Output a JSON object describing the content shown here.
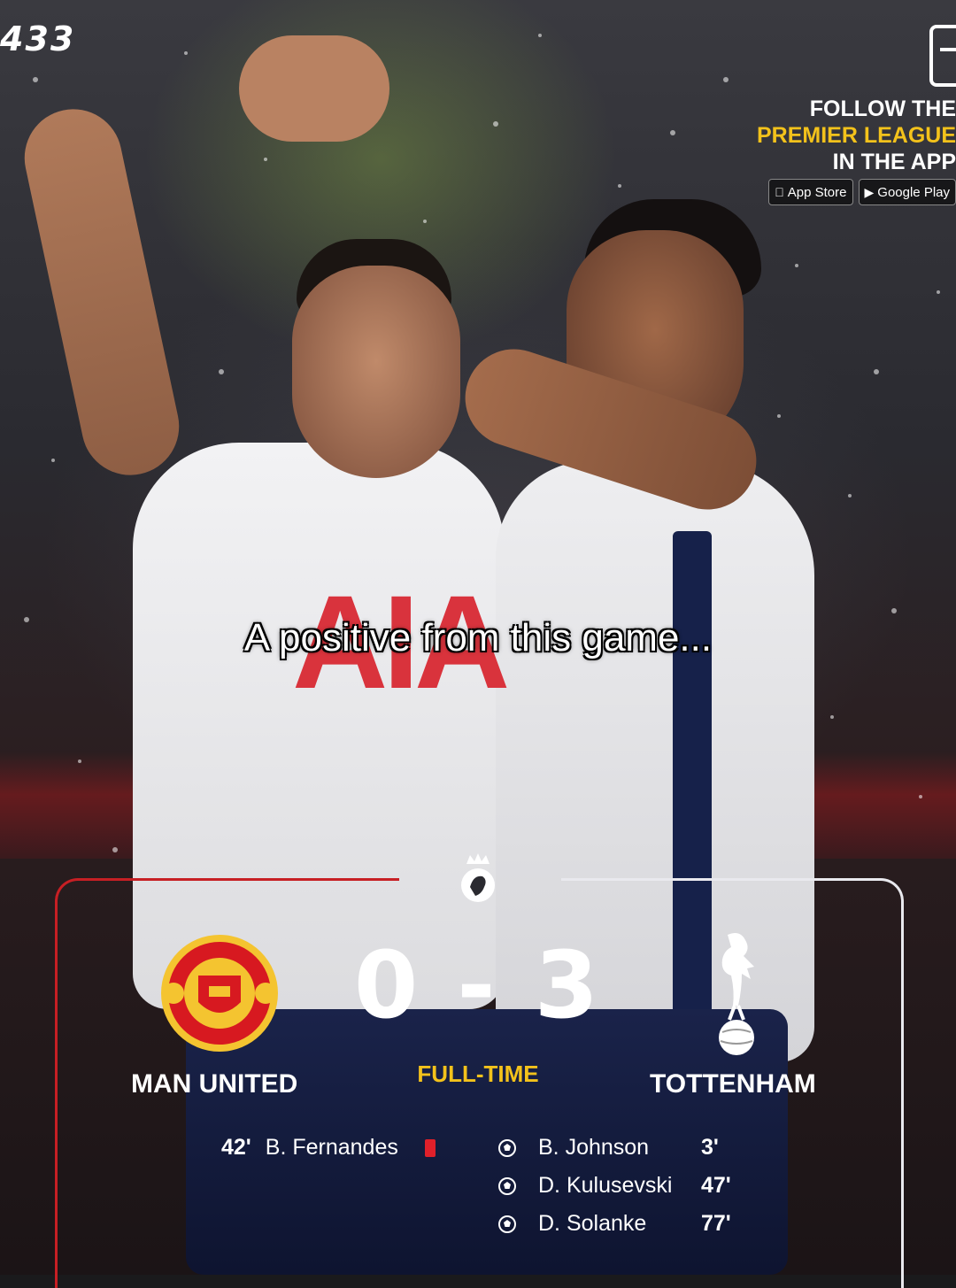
{
  "brand": "433",
  "promo": {
    "line1": "FOLLOW THE",
    "line2": "PREMIER LEAGUE",
    "line3": "IN THE APP",
    "app_store": "App Store",
    "google_play": "Google Play"
  },
  "caption": "A positive from this game...",
  "sponsor": "AIA",
  "match": {
    "home_team": "MAN UNITED",
    "away_team": "TOTTENHAM",
    "score": "0 - 3",
    "status": "FULL-TIME",
    "home_events": [
      {
        "minute": "42'",
        "player": "B. Fernandes",
        "type": "red-card"
      }
    ],
    "away_events": [
      {
        "player": "B. Johnson",
        "minute": "3'",
        "type": "goal"
      },
      {
        "player": "D. Kulusevski",
        "minute": "47'",
        "type": "goal"
      },
      {
        "player": "D. Solanke",
        "minute": "77'",
        "type": "goal"
      }
    ]
  },
  "colors": {
    "home_accent": "#c71f24",
    "away_accent": "#e9e9ee",
    "highlight": "#f3c21b",
    "red_card": "#e0202a"
  },
  "icons": [
    "phone-icon",
    "apple-icon",
    "play-store-icon",
    "premier-league-logo",
    "man-united-crest",
    "tottenham-crest",
    "football-icon",
    "red-card-icon"
  ]
}
